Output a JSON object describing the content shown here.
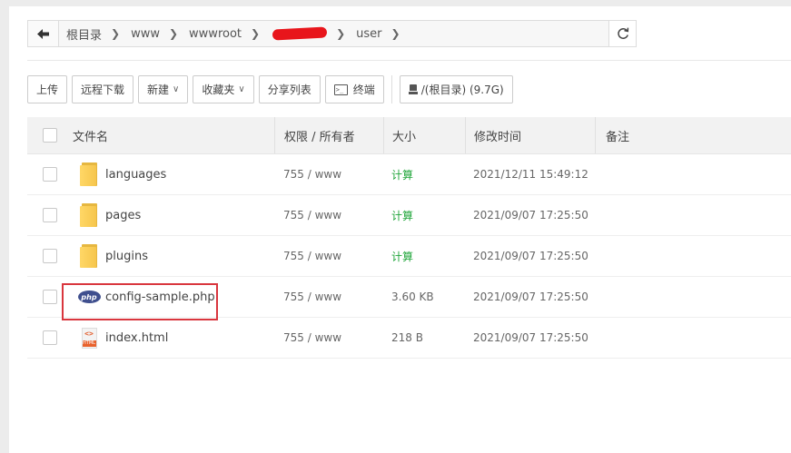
{
  "breadcrumb": {
    "items": [
      "根目录",
      "www",
      "wwwroot",
      "",
      "user"
    ],
    "back_icon": "arrow-left-icon",
    "refresh_icon": "refresh-icon"
  },
  "toolbar": {
    "upload": "上传",
    "remote_download": "远程下载",
    "new": "新建",
    "favorites": "收藏夹",
    "share_list": "分享列表",
    "terminal": "终端",
    "terminal_icon_text": ">_",
    "disk": "/(根目录) (9.7G)"
  },
  "table": {
    "headers": {
      "name": "文件名",
      "perm": "权限 / 所有者",
      "size": "大小",
      "mtime": "修改时间",
      "note": "备注"
    },
    "rows": [
      {
        "type": "folder",
        "name": "languages",
        "perm": "755 / www",
        "size": "计算",
        "mtime": "2021/12/11 15:49:12"
      },
      {
        "type": "folder",
        "name": "pages",
        "perm": "755 / www",
        "size": "计算",
        "mtime": "2021/09/07 17:25:50"
      },
      {
        "type": "folder",
        "name": "plugins",
        "perm": "755 / www",
        "size": "计算",
        "mtime": "2021/09/07 17:25:50"
      },
      {
        "type": "php",
        "name": "config-sample.php",
        "perm": "755 / www",
        "size": "3.60 KB",
        "mtime": "2021/09/07 17:25:50"
      },
      {
        "type": "html",
        "name": "index.html",
        "perm": "755 / www",
        "size": "218 B",
        "mtime": "2021/09/07 17:25:50"
      }
    ]
  },
  "file_icons": {
    "php_text": "php",
    "html_code": "<>",
    "html_tag": "HTML"
  },
  "colors": {
    "accent_green": "#20a53a",
    "highlight_red": "#d9363e",
    "redaction_red": "#e8151b"
  }
}
